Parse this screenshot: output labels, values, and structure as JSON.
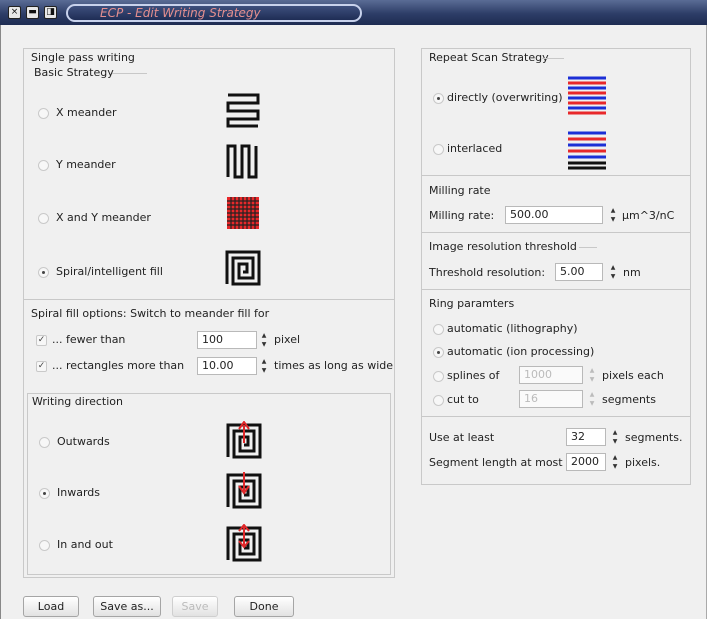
{
  "window": {
    "title": "ECP - Edit Writing Strategy",
    "controls": [
      "×",
      "▬",
      "◨"
    ]
  },
  "single_pass": {
    "title": "Single pass writing",
    "basic_strategy": {
      "title": "Basic Strategy",
      "options": [
        {
          "label": "X meander",
          "selected": false,
          "icon": "x-meander-icon"
        },
        {
          "label": "Y meander",
          "selected": false,
          "icon": "y-meander-icon"
        },
        {
          "label": "X and Y meander",
          "selected": false,
          "icon": "xy-meander-icon"
        },
        {
          "label": "Spiral/intelligent fill",
          "selected": true,
          "icon": "spiral-icon"
        }
      ]
    },
    "spiral_options": {
      "title": "Spiral fill options: Switch to meander fill for",
      "fewer": {
        "label": "... fewer than",
        "value": "100",
        "unit": "pixel",
        "checked": true
      },
      "rect": {
        "label": "... rectangles more than",
        "value": "10.00",
        "unit": "times as long as wide",
        "checked": true
      }
    },
    "writing_direction": {
      "title": "Writing direction",
      "options": [
        {
          "label": "Outwards",
          "selected": false,
          "icon": "spiral-outwards-icon"
        },
        {
          "label": "Inwards",
          "selected": true,
          "icon": "spiral-inwards-icon"
        },
        {
          "label": "In and out",
          "selected": false,
          "icon": "spiral-in-out-icon"
        }
      ]
    }
  },
  "repeat": {
    "title": "Repeat Scan Strategy",
    "options": [
      {
        "label": "directly (overwriting)",
        "selected": true
      },
      {
        "label": "interlaced",
        "selected": false
      }
    ]
  },
  "milling": {
    "title": "Milling rate",
    "label": "Milling rate:",
    "value": "500.00",
    "unit": "µm^3/nC"
  },
  "resolution": {
    "title": "Image resolution threshold",
    "label": "Threshold resolution:",
    "value": "5.00",
    "unit": "nm"
  },
  "ring": {
    "title": "Ring paramters",
    "options": [
      {
        "label": "automatic (lithography)",
        "selected": false
      },
      {
        "label": "automatic (ion processing)",
        "selected": true
      },
      {
        "label": "splines of",
        "selected": false
      },
      {
        "label": "cut to",
        "selected": false
      }
    ],
    "splines_value": "1000",
    "splines_unit": "pixels each",
    "cut_value": "16",
    "cut_unit": "segments"
  },
  "limits": {
    "use_at_least_label": "Use at least",
    "use_at_least_value": "32",
    "use_at_least_unit": "segments.",
    "seg_len_label": "Segment length at most",
    "seg_len_value": "2000",
    "seg_len_unit": "pixels."
  },
  "buttons": {
    "load": "Load",
    "save_as": "Save as...",
    "save": "Save",
    "done": "Done"
  },
  "colors": {
    "stripe_red": "#e8282a",
    "stripe_blue": "#1c2fd6",
    "arrow_red": "#e0282a"
  }
}
